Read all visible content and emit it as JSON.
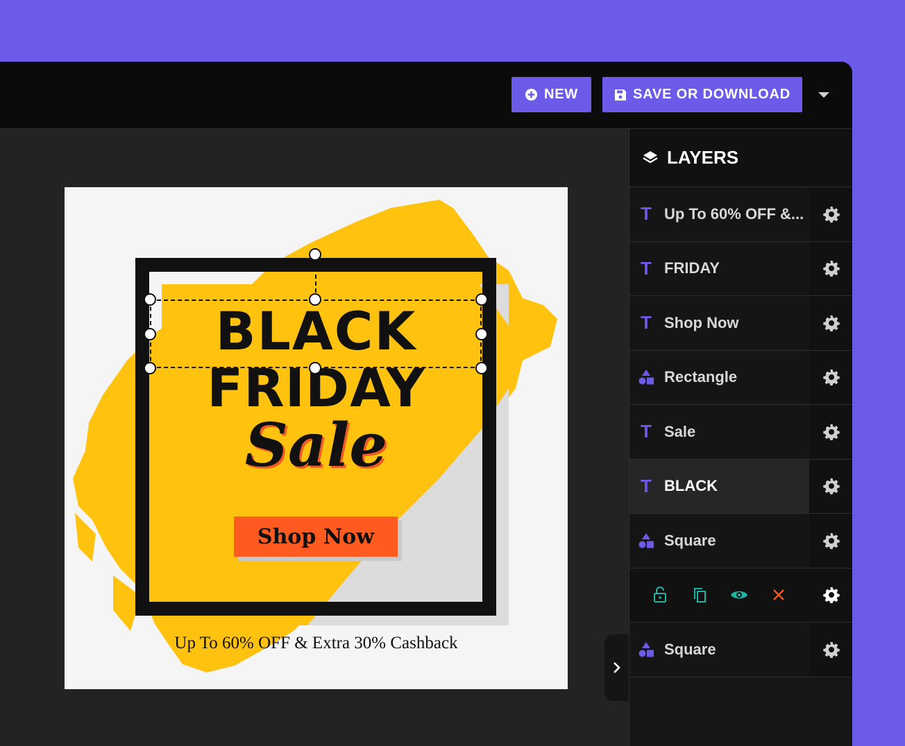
{
  "toolbar": {
    "new_label": "NEW",
    "save_label": "SAVE OR DOWNLOAD"
  },
  "design": {
    "title_line1": "BLACK",
    "title_line2": "FRIDAY",
    "script": "Sale",
    "button": "Shop Now",
    "promo": "Up To 60% OFF & Extra 30% Cashback"
  },
  "layers": {
    "title": "LAYERS",
    "items": [
      {
        "label": "Up To 60% OFF &...",
        "type": "text"
      },
      {
        "label": "FRIDAY",
        "type": "text"
      },
      {
        "label": "Shop Now",
        "type": "text"
      },
      {
        "label": "Rectangle",
        "type": "shape"
      },
      {
        "label": "Sale",
        "type": "text"
      },
      {
        "label": "BLACK",
        "type": "text"
      },
      {
        "label": "Square",
        "type": "shape"
      },
      {
        "label": "Square",
        "type": "shape"
      }
    ]
  },
  "colors": {
    "accent": "#6b5be8",
    "brush": "#ffc20e",
    "button": "#ff5a1f",
    "tool_teal": "#1fb5a5",
    "tool_delete": "#f05a24"
  }
}
